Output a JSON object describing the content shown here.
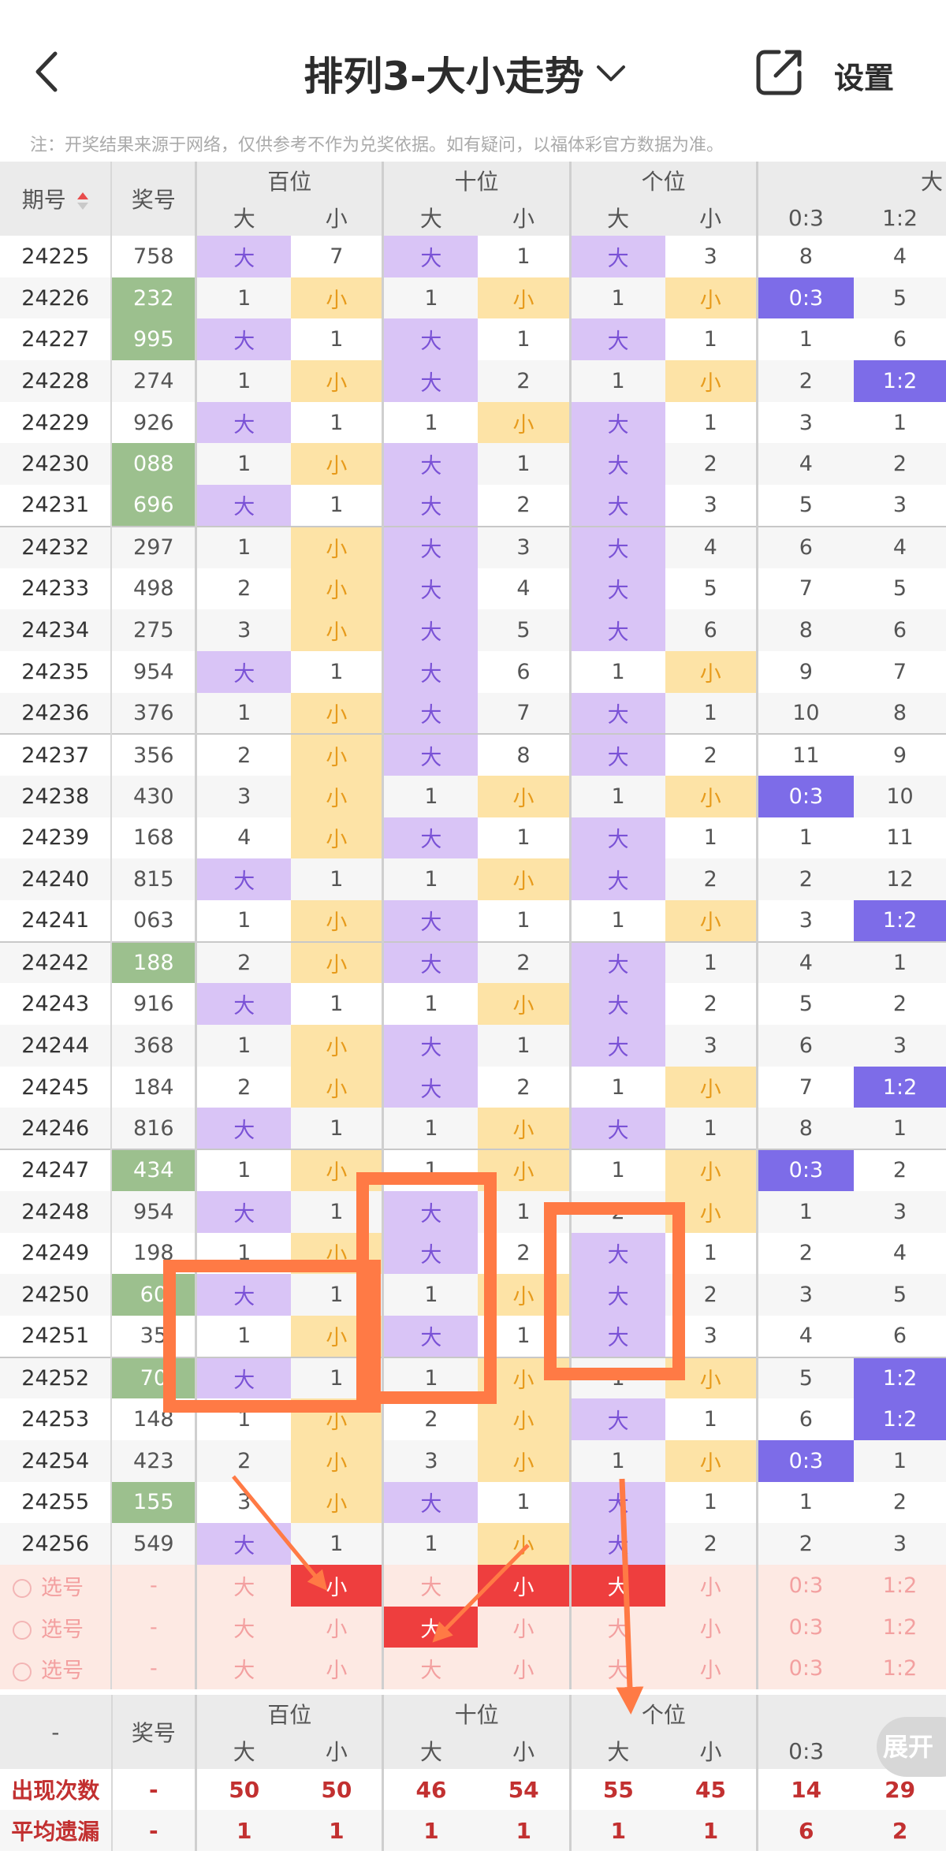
{
  "header": {
    "title": "排列3-大小走势",
    "settings_label": "设置",
    "notice": "注：开奖结果来源于网络，仅供参考不作为兑奖依据。如有疑问，以福体彩官方数据为准。"
  },
  "columns": {
    "period": "期号",
    "draw": "奖号",
    "groups": [
      "百位",
      "十位",
      "个位",
      "大"
    ],
    "sub_big": "大",
    "sub_small": "小",
    "ratio_a": "0:3",
    "ratio_b": "1:2"
  },
  "rows": [
    {
      "p": "24225",
      "d": "758",
      "hl": false,
      "h": [
        "大",
        "7"
      ],
      "t": [
        "大",
        "1"
      ],
      "u": [
        "大",
        "3"
      ],
      "r": [
        "8",
        "4"
      ]
    },
    {
      "p": "24226",
      "d": "232",
      "hl": true,
      "h": [
        "1",
        "小"
      ],
      "t": [
        "1",
        "小"
      ],
      "u": [
        "1",
        "小"
      ],
      "r": [
        "0:3",
        "5"
      ]
    },
    {
      "p": "24227",
      "d": "995",
      "hl": true,
      "h": [
        "大",
        "1"
      ],
      "t": [
        "大",
        "1"
      ],
      "u": [
        "大",
        "1"
      ],
      "r": [
        "1",
        "6"
      ]
    },
    {
      "p": "24228",
      "d": "274",
      "hl": false,
      "h": [
        "1",
        "小"
      ],
      "t": [
        "大",
        "2"
      ],
      "u": [
        "1",
        "小"
      ],
      "r": [
        "2",
        "1:2"
      ]
    },
    {
      "p": "24229",
      "d": "926",
      "hl": false,
      "h": [
        "大",
        "1"
      ],
      "t": [
        "1",
        "小"
      ],
      "u": [
        "大",
        "1"
      ],
      "r": [
        "3",
        "1"
      ]
    },
    {
      "p": "24230",
      "d": "088",
      "hl": true,
      "h": [
        "1",
        "小"
      ],
      "t": [
        "大",
        "1"
      ],
      "u": [
        "大",
        "2"
      ],
      "r": [
        "4",
        "2"
      ]
    },
    {
      "p": "24231",
      "d": "696",
      "hl": true,
      "h": [
        "大",
        "1"
      ],
      "t": [
        "大",
        "2"
      ],
      "u": [
        "大",
        "3"
      ],
      "r": [
        "5",
        "3"
      ]
    },
    {
      "p": "24232",
      "d": "297",
      "hl": false,
      "h": [
        "1",
        "小"
      ],
      "t": [
        "大",
        "3"
      ],
      "u": [
        "大",
        "4"
      ],
      "r": [
        "6",
        "4"
      ]
    },
    {
      "p": "24233",
      "d": "498",
      "hl": false,
      "h": [
        "2",
        "小"
      ],
      "t": [
        "大",
        "4"
      ],
      "u": [
        "大",
        "5"
      ],
      "r": [
        "7",
        "5"
      ]
    },
    {
      "p": "24234",
      "d": "275",
      "hl": false,
      "h": [
        "3",
        "小"
      ],
      "t": [
        "大",
        "5"
      ],
      "u": [
        "大",
        "6"
      ],
      "r": [
        "8",
        "6"
      ]
    },
    {
      "p": "24235",
      "d": "954",
      "hl": false,
      "h": [
        "大",
        "1"
      ],
      "t": [
        "大",
        "6"
      ],
      "u": [
        "1",
        "小"
      ],
      "r": [
        "9",
        "7"
      ]
    },
    {
      "p": "24236",
      "d": "376",
      "hl": false,
      "h": [
        "1",
        "小"
      ],
      "t": [
        "大",
        "7"
      ],
      "u": [
        "大",
        "1"
      ],
      "r": [
        "10",
        "8"
      ]
    },
    {
      "p": "24237",
      "d": "356",
      "hl": false,
      "h": [
        "2",
        "小"
      ],
      "t": [
        "大",
        "8"
      ],
      "u": [
        "大",
        "2"
      ],
      "r": [
        "11",
        "9"
      ]
    },
    {
      "p": "24238",
      "d": "430",
      "hl": false,
      "h": [
        "3",
        "小"
      ],
      "t": [
        "1",
        "小"
      ],
      "u": [
        "1",
        "小"
      ],
      "r": [
        "0:3",
        "10"
      ]
    },
    {
      "p": "24239",
      "d": "168",
      "hl": false,
      "h": [
        "4",
        "小"
      ],
      "t": [
        "大",
        "1"
      ],
      "u": [
        "大",
        "1"
      ],
      "r": [
        "1",
        "11"
      ]
    },
    {
      "p": "24240",
      "d": "815",
      "hl": false,
      "h": [
        "大",
        "1"
      ],
      "t": [
        "1",
        "小"
      ],
      "u": [
        "大",
        "2"
      ],
      "r": [
        "2",
        "12"
      ]
    },
    {
      "p": "24241",
      "d": "063",
      "hl": false,
      "h": [
        "1",
        "小"
      ],
      "t": [
        "大",
        "1"
      ],
      "u": [
        "1",
        "小"
      ],
      "r": [
        "3",
        "1:2"
      ]
    },
    {
      "p": "24242",
      "d": "188",
      "hl": true,
      "h": [
        "2",
        "小"
      ],
      "t": [
        "大",
        "2"
      ],
      "u": [
        "大",
        "1"
      ],
      "r": [
        "4",
        "1"
      ]
    },
    {
      "p": "24243",
      "d": "916",
      "hl": false,
      "h": [
        "大",
        "1"
      ],
      "t": [
        "1",
        "小"
      ],
      "u": [
        "大",
        "2"
      ],
      "r": [
        "5",
        "2"
      ]
    },
    {
      "p": "24244",
      "d": "368",
      "hl": false,
      "h": [
        "1",
        "小"
      ],
      "t": [
        "大",
        "1"
      ],
      "u": [
        "大",
        "3"
      ],
      "r": [
        "6",
        "3"
      ]
    },
    {
      "p": "24245",
      "d": "184",
      "hl": false,
      "h": [
        "2",
        "小"
      ],
      "t": [
        "大",
        "2"
      ],
      "u": [
        "1",
        "小"
      ],
      "r": [
        "7",
        "1:2"
      ]
    },
    {
      "p": "24246",
      "d": "816",
      "hl": false,
      "h": [
        "大",
        "1"
      ],
      "t": [
        "1",
        "小"
      ],
      "u": [
        "大",
        "1"
      ],
      "r": [
        "8",
        "1"
      ]
    },
    {
      "p": "24247",
      "d": "434",
      "hl": true,
      "h": [
        "1",
        "小"
      ],
      "t": [
        "1",
        "小"
      ],
      "u": [
        "1",
        "小"
      ],
      "r": [
        "0:3",
        "2"
      ]
    },
    {
      "p": "24248",
      "d": "954",
      "hl": false,
      "h": [
        "大",
        "1"
      ],
      "t": [
        "大",
        "1"
      ],
      "u": [
        "2",
        "小"
      ],
      "r": [
        "1",
        "3"
      ]
    },
    {
      "p": "24249",
      "d": "198",
      "hl": false,
      "h": [
        "1",
        "小"
      ],
      "t": [
        "大",
        "2"
      ],
      "u": [
        "大",
        "1"
      ],
      "r": [
        "2",
        "4"
      ]
    },
    {
      "p": "24250",
      "d": "60",
      "hl": true,
      "h": [
        "大",
        "1"
      ],
      "t": [
        "1",
        "小"
      ],
      "u": [
        "大",
        "2"
      ],
      "r": [
        "3",
        "5"
      ]
    },
    {
      "p": "24251",
      "d": "35",
      "hl": false,
      "h": [
        "1",
        "小"
      ],
      "t": [
        "大",
        "1"
      ],
      "u": [
        "大",
        "3"
      ],
      "r": [
        "4",
        "6"
      ]
    },
    {
      "p": "24252",
      "d": "70",
      "hl": true,
      "h": [
        "大",
        "1"
      ],
      "t": [
        "1",
        "小"
      ],
      "u": [
        "1",
        "小"
      ],
      "r": [
        "5",
        "1:2"
      ]
    },
    {
      "p": "24253",
      "d": "148",
      "hl": false,
      "h": [
        "1",
        "小"
      ],
      "t": [
        "2",
        "小"
      ],
      "u": [
        "大",
        "1"
      ],
      "r": [
        "6",
        "1:2"
      ]
    },
    {
      "p": "24254",
      "d": "423",
      "hl": false,
      "h": [
        "2",
        "小"
      ],
      "t": [
        "3",
        "小"
      ],
      "u": [
        "1",
        "小"
      ],
      "r": [
        "0:3",
        "1"
      ]
    },
    {
      "p": "24255",
      "d": "155",
      "hl": true,
      "h": [
        "3",
        "小"
      ],
      "t": [
        "大",
        "1"
      ],
      "u": [
        "大",
        "1"
      ],
      "r": [
        "1",
        "2"
      ]
    },
    {
      "p": "24256",
      "d": "549",
      "hl": false,
      "h": [
        "大",
        "1"
      ],
      "t": [
        "1",
        "小"
      ],
      "u": [
        "大",
        "2"
      ],
      "r": [
        "2",
        "3"
      ]
    }
  ],
  "select_rows": [
    {
      "label": "选号",
      "dash": "-",
      "cells": [
        "大",
        "小",
        "大",
        "小",
        "大",
        "小",
        "0:3",
        "1:2"
      ],
      "picked": [
        1,
        3,
        4
      ]
    },
    {
      "label": "选号",
      "dash": "-",
      "cells": [
        "大",
        "小",
        "大",
        "小",
        "大",
        "小",
        "0:3",
        "1:2"
      ],
      "picked": [
        2
      ]
    },
    {
      "label": "选号",
      "dash": "-",
      "cells": [
        "大",
        "小",
        "大",
        "小",
        "大",
        "小",
        "0:3",
        "1:2"
      ],
      "picked": []
    }
  ],
  "footer": {
    "dash": "-",
    "draw": "奖号",
    "groups": [
      "百位",
      "十位",
      "个位"
    ],
    "stats": [
      {
        "label": "出现次数",
        "dash": "-",
        "vals": [
          "50",
          "50",
          "46",
          "54",
          "55",
          "45",
          "14",
          "29"
        ]
      },
      {
        "label": "平均遗漏",
        "dash": "-",
        "vals": [
          "1",
          "1",
          "1",
          "1",
          "1",
          "1",
          "6",
          "2"
        ]
      }
    ]
  },
  "expand_label": "展开",
  "colors": {
    "big_bg": "#d9c4f6",
    "small_bg": "#fde3a6",
    "ratio_hl": "#7d6ce8",
    "draw_hl": "#9cc08e",
    "picked": "#ee3e3e",
    "annotation": "#ff7a45"
  },
  "icons": {
    "back": "chevron-left-icon",
    "title_dropdown": "chevron-down-icon",
    "share": "share-icon",
    "sort": "sort-icon"
  }
}
